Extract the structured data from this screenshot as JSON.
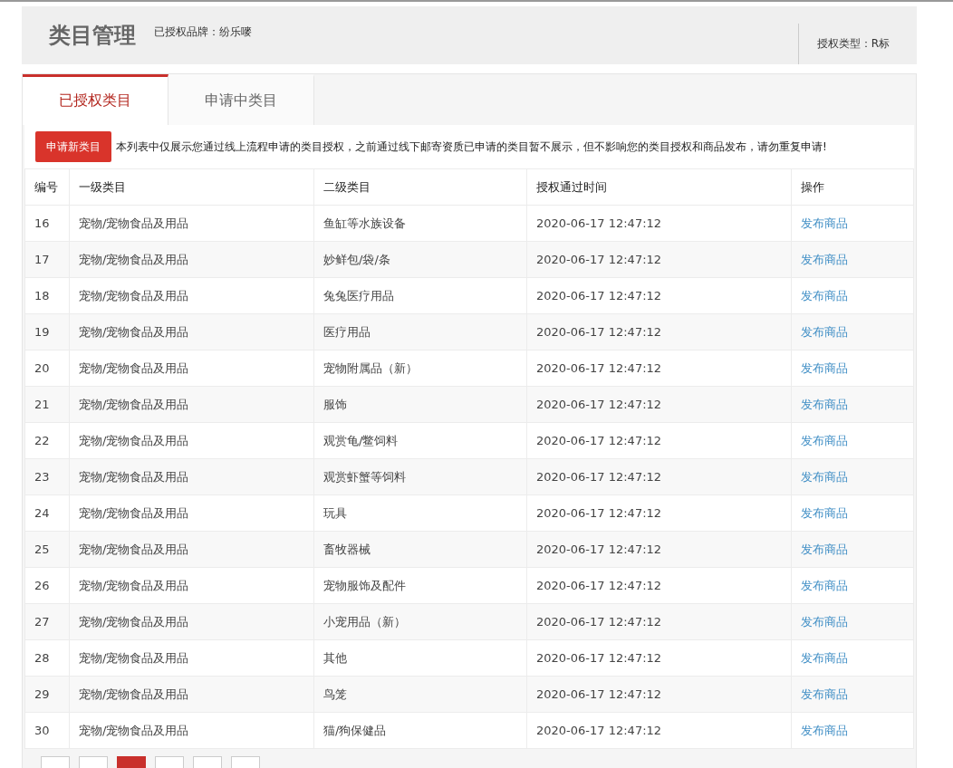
{
  "header": {
    "title": "类目管理",
    "brand": "已授权品牌：纷乐嘜",
    "auth_type": "授权类型：R标"
  },
  "tabs": [
    {
      "label": "已授权类目",
      "selected": true
    },
    {
      "label": "申请中类目",
      "selected": false
    }
  ],
  "apply_button": "申请新类目",
  "notice": "本列表中仅展示您通过线上流程申请的类目授权，之前通过线下邮寄资质已申请的类目暂不展示，但不影响您的类目授权和商品发布，请勿重复申请!",
  "table": {
    "columns": [
      "编号",
      "一级类目",
      "二级类目",
      "授权通过时间",
      "操作"
    ],
    "rows": [
      {
        "id": "16",
        "level1": "宠物/宠物食品及用品",
        "level2": "鱼缸等水族设备",
        "time": "2020-06-17 12:47:12",
        "action": "发布商品"
      },
      {
        "id": "17",
        "level1": "宠物/宠物食品及用品",
        "level2": "妙鲜包/袋/条",
        "time": "2020-06-17 12:47:12",
        "action": "发布商品"
      },
      {
        "id": "18",
        "level1": "宠物/宠物食品及用品",
        "level2": "兔兔医疗用品",
        "time": "2020-06-17 12:47:12",
        "action": "发布商品"
      },
      {
        "id": "19",
        "level1": "宠物/宠物食品及用品",
        "level2": "医疗用品",
        "time": "2020-06-17 12:47:12",
        "action": "发布商品"
      },
      {
        "id": "20",
        "level1": "宠物/宠物食品及用品",
        "level2": "宠物附属品（新）",
        "time": "2020-06-17 12:47:12",
        "action": "发布商品"
      },
      {
        "id": "21",
        "level1": "宠物/宠物食品及用品",
        "level2": "服饰",
        "time": "2020-06-17 12:47:12",
        "action": "发布商品"
      },
      {
        "id": "22",
        "level1": "宠物/宠物食品及用品",
        "level2": "观赏龟/鳖饲料",
        "time": "2020-06-17 12:47:12",
        "action": "发布商品"
      },
      {
        "id": "23",
        "level1": "宠物/宠物食品及用品",
        "level2": "观赏虾蟹等饲料",
        "time": "2020-06-17 12:47:12",
        "action": "发布商品"
      },
      {
        "id": "24",
        "level1": "宠物/宠物食品及用品",
        "level2": "玩具",
        "time": "2020-06-17 12:47:12",
        "action": "发布商品"
      },
      {
        "id": "25",
        "level1": "宠物/宠物食品及用品",
        "level2": "畜牧器械",
        "time": "2020-06-17 12:47:12",
        "action": "发布商品"
      },
      {
        "id": "26",
        "level1": "宠物/宠物食品及用品",
        "level2": "宠物服饰及配件",
        "time": "2020-06-17 12:47:12",
        "action": "发布商品"
      },
      {
        "id": "27",
        "level1": "宠物/宠物食品及用品",
        "level2": "小宠用品（新）",
        "time": "2020-06-17 12:47:12",
        "action": "发布商品"
      },
      {
        "id": "28",
        "level1": "宠物/宠物食品及用品",
        "level2": "其他",
        "time": "2020-06-17 12:47:12",
        "action": "发布商品"
      },
      {
        "id": "29",
        "level1": "宠物/宠物食品及用品",
        "level2": "鸟笼",
        "time": "2020-06-17 12:47:12",
        "action": "发布商品"
      },
      {
        "id": "30",
        "level1": "宠物/宠物食品及用品",
        "level2": "猫/狗保健品",
        "time": "2020-06-17 12:47:12",
        "action": "发布商品"
      }
    ]
  },
  "pager": [
    {
      "selected": false
    },
    {
      "selected": false
    },
    {
      "selected": true
    },
    {
      "selected": false
    },
    {
      "selected": false
    },
    {
      "selected": false
    }
  ]
}
